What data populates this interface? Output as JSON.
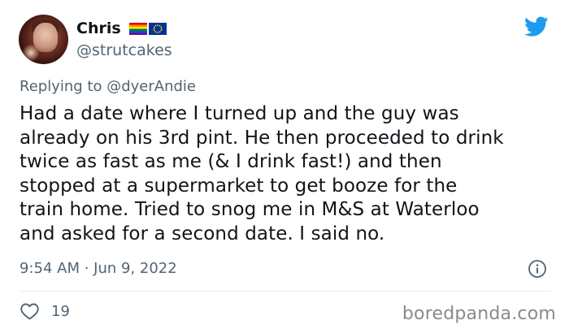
{
  "author": {
    "display_name": "Chris",
    "handle": "@strutcakes"
  },
  "reply": {
    "prefix": "Replying to ",
    "mention": "@dyerAndie"
  },
  "tweet": {
    "text": "Had a date where I turned up and the guy was\nalready on his 3rd pint. He then proceeded to drink\ntwice as fast as me (& I drink fast!) and then\nstopped at a supermarket to get booze for the\ntrain home. Tried to snog me in M&S at Waterloo\nand asked for a second date. I said no.",
    "timestamp": "9:54 AM · Jun 9, 2022"
  },
  "stats": {
    "likes": "19"
  },
  "watermark": "boredpanda.com",
  "icons": {
    "brand": "twitter-bird-icon",
    "info": "info-icon",
    "like": "heart-icon",
    "flags": [
      "rainbow-flag-icon",
      "eu-flag-icon"
    ]
  },
  "colors": {
    "brand_blue": "#1d9bf0",
    "text_primary": "#0f1419",
    "text_secondary": "#536471"
  }
}
